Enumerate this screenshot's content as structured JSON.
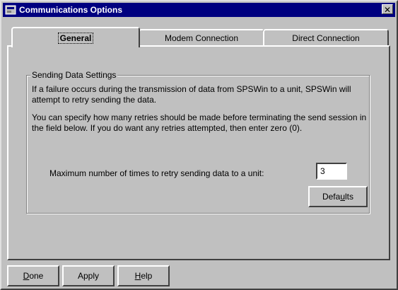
{
  "window": {
    "title": "Communications Options",
    "close_glyph": "✕"
  },
  "tabs": [
    {
      "label": "General",
      "active": true
    },
    {
      "label": "Modem Connection",
      "active": false
    },
    {
      "label": "Direct Connection",
      "active": false
    }
  ],
  "group": {
    "title": "Sending Data Settings",
    "para1": "If a failure occurs during the transmission of data from SPSWin to a unit, SPSWin will attempt to retry sending the data.",
    "para2": "You can specify how many retries should be made before terminating the send session in the field below.  If you do want any retries attempted, then enter zero (0).",
    "retry_label": "Maximum number of times to retry sending data to a unit:",
    "retry_value": "3",
    "defaults_pre": "Defa",
    "defaults_ul": "u",
    "defaults_post": "lts"
  },
  "footer": {
    "done_ul": "D",
    "done_rest": "one",
    "apply_pre": "Apply",
    "help_ul": "H",
    "help_rest": "elp"
  },
  "icons": {
    "app": "window-icon",
    "close": "close-icon"
  }
}
